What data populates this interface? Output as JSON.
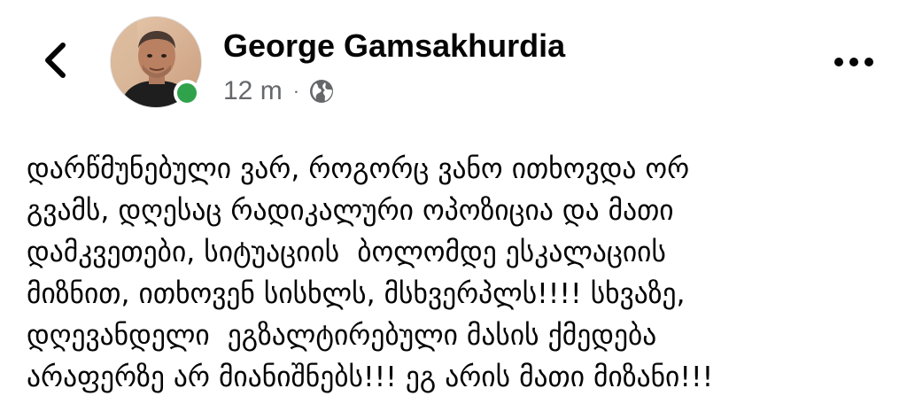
{
  "header": {
    "back_icon": "chevron-left-icon",
    "author": {
      "name": "George Gamsakhurdia",
      "avatar_icon": "profile-photo",
      "online": true,
      "online_color": "#31a24c"
    },
    "meta": {
      "time": "12 m",
      "separator": "·",
      "audience_icon": "globe-icon"
    },
    "more_icon": "more-horizontal-icon"
  },
  "post": {
    "lines": [
      "დარწმუნებული ვარ, როგორც ვანო ითხოვდა ორ",
      "გვამს, დღესაც რადიკალური ოპოზიცია და მათი",
      "დამკვეთები, სიტუაციის  ბოლომდე ესკალაციის",
      "მიზნით, ითხოვენ სისხლს, მსხვერპლს!!!! სხვაზე,",
      "დღევანდელი  ეგზალტირებული მასის ქმედება",
      "არაფერზე არ მიანიშნებს!!! ეგ არის მათი მიზანი!!!"
    ]
  },
  "colors": {
    "text_primary": "#050505",
    "text_secondary": "#65676b",
    "background": "#ffffff"
  }
}
